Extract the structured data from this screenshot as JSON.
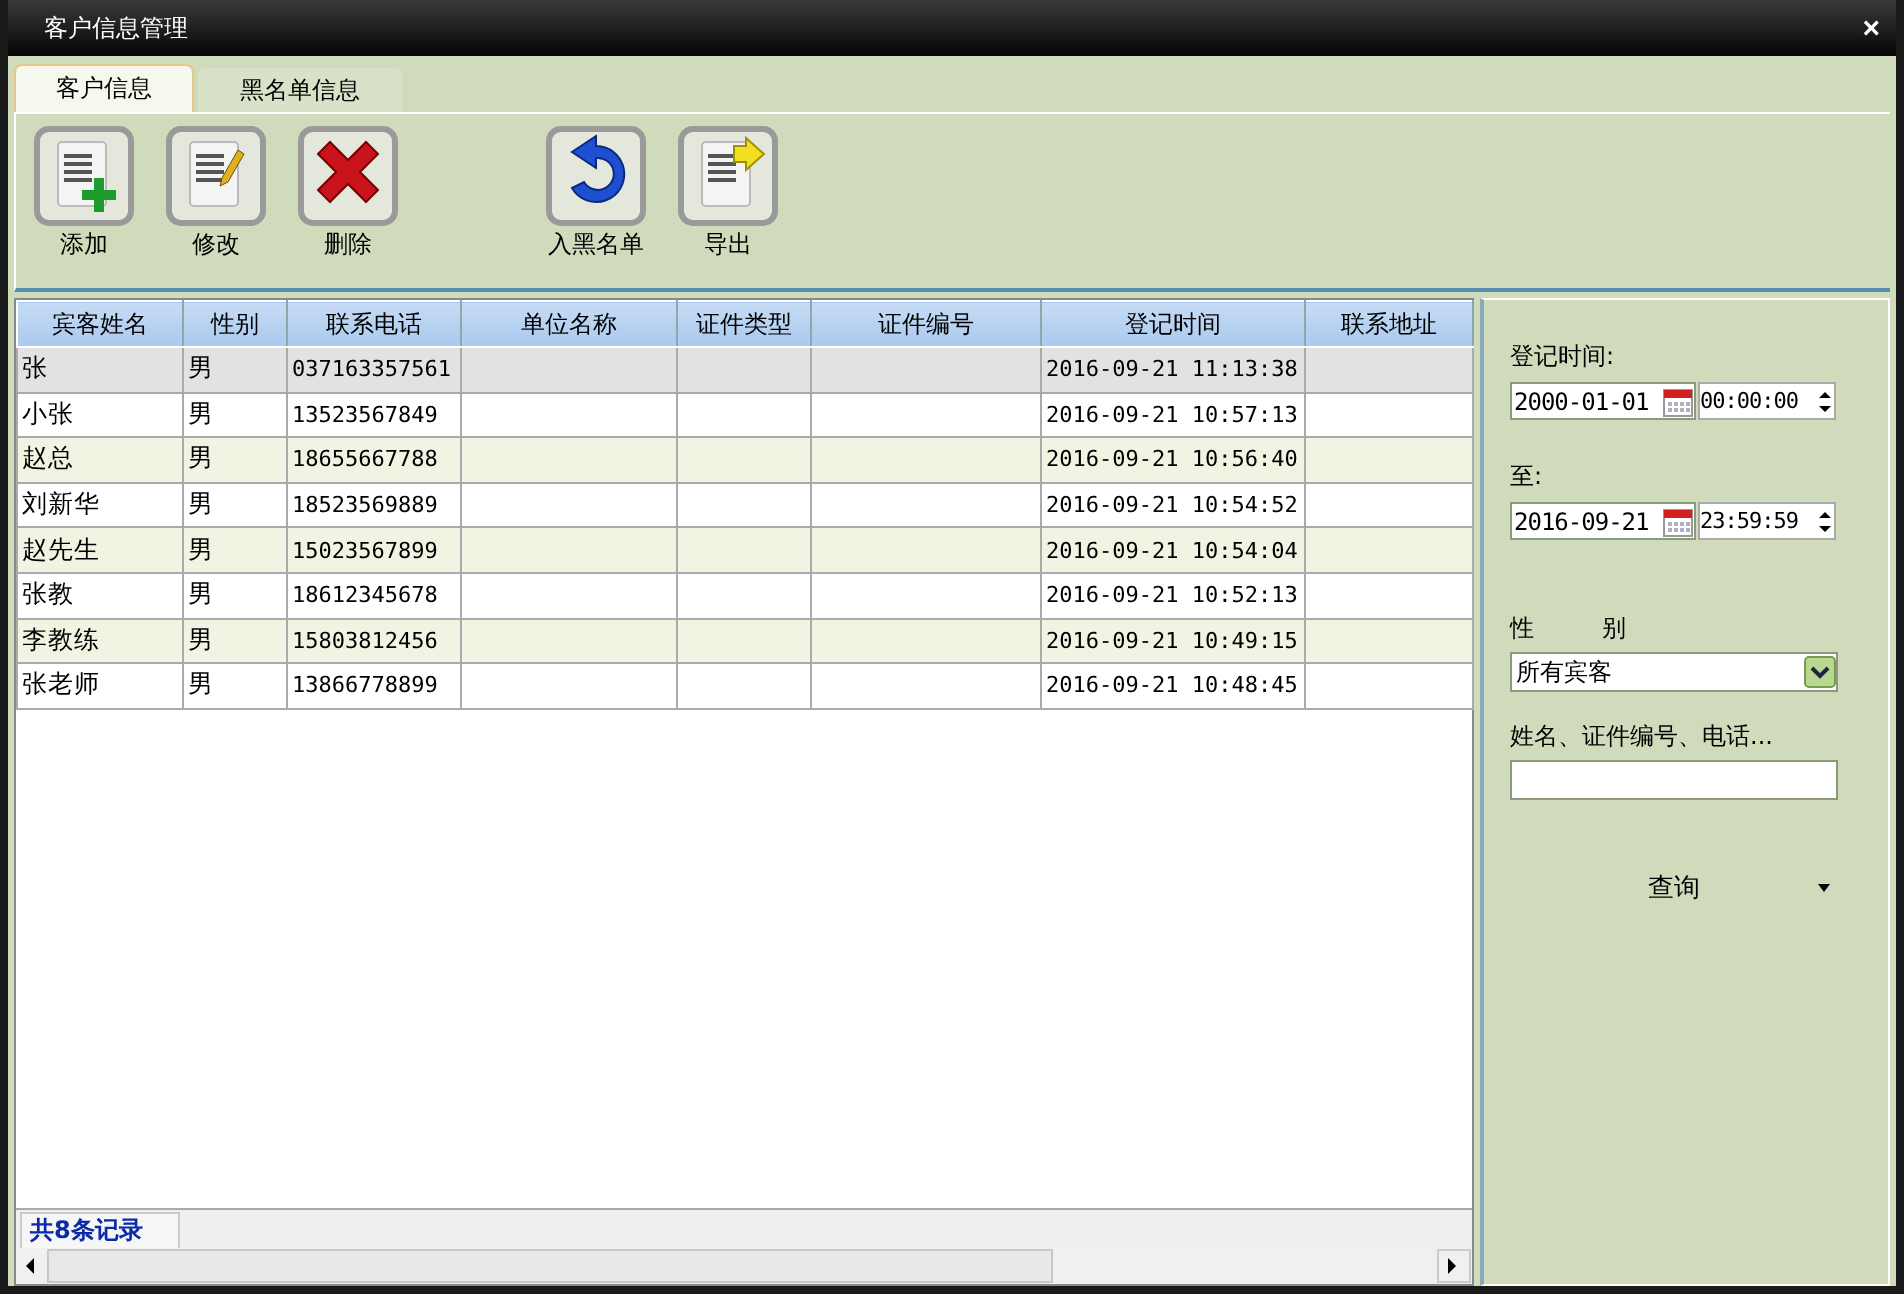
{
  "window": {
    "title": "客户信息管理",
    "close": "×"
  },
  "tabs": [
    {
      "label": "客户信息",
      "selected": true
    },
    {
      "label": "黑名单信息",
      "selected": false
    }
  ],
  "toolbar": {
    "groups": [
      [
        {
          "label": "添加",
          "kind": "add"
        },
        {
          "label": "修改",
          "kind": "edit"
        },
        {
          "label": "删除",
          "kind": "delete"
        }
      ],
      [
        {
          "label": "入黑名单",
          "kind": "blacklist"
        },
        {
          "label": "导出",
          "kind": "export"
        }
      ]
    ]
  },
  "table": {
    "columns": [
      "宾客姓名",
      "性别",
      "联系电话",
      "单位名称",
      "证件类型",
      "证件编号",
      "登记时间",
      "联系地址"
    ],
    "rows": [
      {
        "cells": [
          "张",
          "男",
          "037163357561",
          "",
          "",
          "",
          "2016-09-21 11:13:38",
          ""
        ],
        "selected": true
      },
      {
        "cells": [
          "小张",
          "男",
          "13523567849",
          "",
          "",
          "",
          "2016-09-21 10:57:13",
          ""
        ],
        "selected": false
      },
      {
        "cells": [
          "赵总",
          "男",
          "18655667788",
          "",
          "",
          "",
          "2016-09-21 10:56:40",
          ""
        ],
        "selected": false
      },
      {
        "cells": [
          "刘新华",
          "男",
          "18523569889",
          "",
          "",
          "",
          "2016-09-21 10:54:52",
          ""
        ],
        "selected": false
      },
      {
        "cells": [
          "赵先生",
          "男",
          "15023567899",
          "",
          "",
          "",
          "2016-09-21 10:54:04",
          ""
        ],
        "selected": false
      },
      {
        "cells": [
          "张教",
          "男",
          "18612345678",
          "",
          "",
          "",
          "2016-09-21 10:52:13",
          ""
        ],
        "selected": false
      },
      {
        "cells": [
          "李教练",
          "男",
          "15803812456",
          "",
          "",
          "",
          "2016-09-21 10:49:15",
          ""
        ],
        "selected": false
      },
      {
        "cells": [
          "张老师",
          "男",
          "13866778899",
          "",
          "",
          "",
          "2016-09-21 10:48:45",
          ""
        ],
        "selected": false
      }
    ],
    "record_count": "共8条记录"
  },
  "filter": {
    "from_label": "登记时间:",
    "from_date": "2000-01-01",
    "from_time": "00:00:00",
    "to_label": "至:",
    "to_date": "2016-09-21",
    "to_time": "23:59:59",
    "gender_label": [
      "性",
      "别"
    ],
    "gender_value": "所有宾客",
    "search_label": "姓名、证件编号、电话...",
    "query_button": "查询"
  }
}
